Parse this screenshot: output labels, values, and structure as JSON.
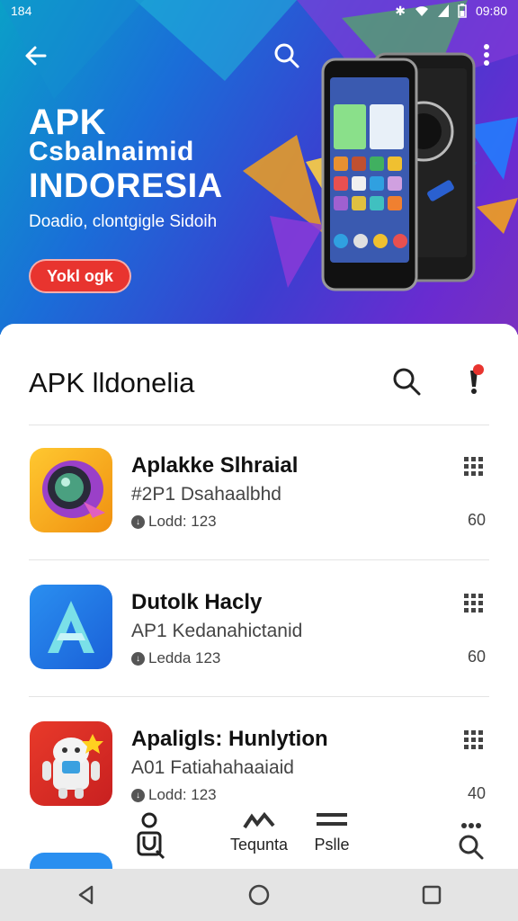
{
  "status_bar": {
    "time_left": "184",
    "time_right": "09:80"
  },
  "hero": {
    "title_line1": "APK",
    "title_line2": "Csbalnaimid",
    "title_line3": "INDORESIA",
    "subtitle": "Doadio, clontgigle Sidoih",
    "button_label": "Yokl ogk",
    "accent_color": "#e8342f"
  },
  "sheet": {
    "title": "APK lldonelia"
  },
  "apps": [
    {
      "name": "Aplakke Slhraial",
      "subtitle": "#2P1 Dsahaalbhd",
      "meta": "Lodd: 123",
      "number": "60",
      "icon": "camera-icon"
    },
    {
      "name": "Dutolk Hacly",
      "subtitle": "AP1 Kedanahictanid",
      "meta": "Ledda 123",
      "number": "60",
      "icon": "a-logo-icon"
    },
    {
      "name": "Apaligls: Hunlytion",
      "subtitle": "A01 Fatiahahaaiaid",
      "meta": "Lodd: 123",
      "number": "40",
      "icon": "android-robot-icon"
    }
  ],
  "tabs": [
    {
      "label": "",
      "icon": "person-bag-icon"
    },
    {
      "label": "Tequnta",
      "icon": "chart-icon"
    },
    {
      "label": "Pslle",
      "icon": "list-icon"
    },
    {
      "label": "",
      "icon": "search-icon"
    }
  ]
}
